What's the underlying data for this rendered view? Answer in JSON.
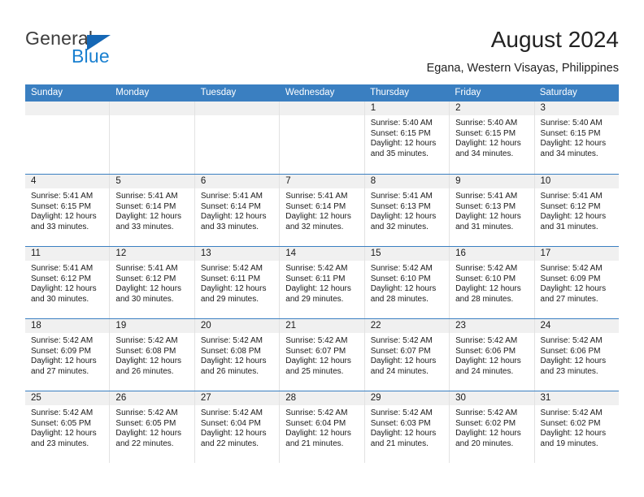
{
  "brand": {
    "name_top": "General",
    "name_bottom": "Blue",
    "triangle_color": "#1567b5",
    "blue_text_color": "#1a80d0"
  },
  "header": {
    "title": "August 2024",
    "location": "Egana, Western Visayas, Philippines"
  },
  "calendar": {
    "header_bg": "#3a7fc1",
    "day_band_bg": "#f0f0f0",
    "weekdays": [
      "Sunday",
      "Monday",
      "Tuesday",
      "Wednesday",
      "Thursday",
      "Friday",
      "Saturday"
    ],
    "weeks": [
      [
        {
          "day": "",
          "lines": []
        },
        {
          "day": "",
          "lines": []
        },
        {
          "day": "",
          "lines": []
        },
        {
          "day": "",
          "lines": []
        },
        {
          "day": "1",
          "lines": [
            "Sunrise: 5:40 AM",
            "Sunset: 6:15 PM",
            "Daylight: 12 hours and 35 minutes."
          ]
        },
        {
          "day": "2",
          "lines": [
            "Sunrise: 5:40 AM",
            "Sunset: 6:15 PM",
            "Daylight: 12 hours and 34 minutes."
          ]
        },
        {
          "day": "3",
          "lines": [
            "Sunrise: 5:40 AM",
            "Sunset: 6:15 PM",
            "Daylight: 12 hours and 34 minutes."
          ]
        }
      ],
      [
        {
          "day": "4",
          "lines": [
            "Sunrise: 5:41 AM",
            "Sunset: 6:15 PM",
            "Daylight: 12 hours and 33 minutes."
          ]
        },
        {
          "day": "5",
          "lines": [
            "Sunrise: 5:41 AM",
            "Sunset: 6:14 PM",
            "Daylight: 12 hours and 33 minutes."
          ]
        },
        {
          "day": "6",
          "lines": [
            "Sunrise: 5:41 AM",
            "Sunset: 6:14 PM",
            "Daylight: 12 hours and 33 minutes."
          ]
        },
        {
          "day": "7",
          "lines": [
            "Sunrise: 5:41 AM",
            "Sunset: 6:14 PM",
            "Daylight: 12 hours and 32 minutes."
          ]
        },
        {
          "day": "8",
          "lines": [
            "Sunrise: 5:41 AM",
            "Sunset: 6:13 PM",
            "Daylight: 12 hours and 32 minutes."
          ]
        },
        {
          "day": "9",
          "lines": [
            "Sunrise: 5:41 AM",
            "Sunset: 6:13 PM",
            "Daylight: 12 hours and 31 minutes."
          ]
        },
        {
          "day": "10",
          "lines": [
            "Sunrise: 5:41 AM",
            "Sunset: 6:12 PM",
            "Daylight: 12 hours and 31 minutes."
          ]
        }
      ],
      [
        {
          "day": "11",
          "lines": [
            "Sunrise: 5:41 AM",
            "Sunset: 6:12 PM",
            "Daylight: 12 hours and 30 minutes."
          ]
        },
        {
          "day": "12",
          "lines": [
            "Sunrise: 5:41 AM",
            "Sunset: 6:12 PM",
            "Daylight: 12 hours and 30 minutes."
          ]
        },
        {
          "day": "13",
          "lines": [
            "Sunrise: 5:42 AM",
            "Sunset: 6:11 PM",
            "Daylight: 12 hours and 29 minutes."
          ]
        },
        {
          "day": "14",
          "lines": [
            "Sunrise: 5:42 AM",
            "Sunset: 6:11 PM",
            "Daylight: 12 hours and 29 minutes."
          ]
        },
        {
          "day": "15",
          "lines": [
            "Sunrise: 5:42 AM",
            "Sunset: 6:10 PM",
            "Daylight: 12 hours and 28 minutes."
          ]
        },
        {
          "day": "16",
          "lines": [
            "Sunrise: 5:42 AM",
            "Sunset: 6:10 PM",
            "Daylight: 12 hours and 28 minutes."
          ]
        },
        {
          "day": "17",
          "lines": [
            "Sunrise: 5:42 AM",
            "Sunset: 6:09 PM",
            "Daylight: 12 hours and 27 minutes."
          ]
        }
      ],
      [
        {
          "day": "18",
          "lines": [
            "Sunrise: 5:42 AM",
            "Sunset: 6:09 PM",
            "Daylight: 12 hours and 27 minutes."
          ]
        },
        {
          "day": "19",
          "lines": [
            "Sunrise: 5:42 AM",
            "Sunset: 6:08 PM",
            "Daylight: 12 hours and 26 minutes."
          ]
        },
        {
          "day": "20",
          "lines": [
            "Sunrise: 5:42 AM",
            "Sunset: 6:08 PM",
            "Daylight: 12 hours and 26 minutes."
          ]
        },
        {
          "day": "21",
          "lines": [
            "Sunrise: 5:42 AM",
            "Sunset: 6:07 PM",
            "Daylight: 12 hours and 25 minutes."
          ]
        },
        {
          "day": "22",
          "lines": [
            "Sunrise: 5:42 AM",
            "Sunset: 6:07 PM",
            "Daylight: 12 hours and 24 minutes."
          ]
        },
        {
          "day": "23",
          "lines": [
            "Sunrise: 5:42 AM",
            "Sunset: 6:06 PM",
            "Daylight: 12 hours and 24 minutes."
          ]
        },
        {
          "day": "24",
          "lines": [
            "Sunrise: 5:42 AM",
            "Sunset: 6:06 PM",
            "Daylight: 12 hours and 23 minutes."
          ]
        }
      ],
      [
        {
          "day": "25",
          "lines": [
            "Sunrise: 5:42 AM",
            "Sunset: 6:05 PM",
            "Daylight: 12 hours and 23 minutes."
          ]
        },
        {
          "day": "26",
          "lines": [
            "Sunrise: 5:42 AM",
            "Sunset: 6:05 PM",
            "Daylight: 12 hours and 22 minutes."
          ]
        },
        {
          "day": "27",
          "lines": [
            "Sunrise: 5:42 AM",
            "Sunset: 6:04 PM",
            "Daylight: 12 hours and 22 minutes."
          ]
        },
        {
          "day": "28",
          "lines": [
            "Sunrise: 5:42 AM",
            "Sunset: 6:04 PM",
            "Daylight: 12 hours and 21 minutes."
          ]
        },
        {
          "day": "29",
          "lines": [
            "Sunrise: 5:42 AM",
            "Sunset: 6:03 PM",
            "Daylight: 12 hours and 21 minutes."
          ]
        },
        {
          "day": "30",
          "lines": [
            "Sunrise: 5:42 AM",
            "Sunset: 6:02 PM",
            "Daylight: 12 hours and 20 minutes."
          ]
        },
        {
          "day": "31",
          "lines": [
            "Sunrise: 5:42 AM",
            "Sunset: 6:02 PM",
            "Daylight: 12 hours and 19 minutes."
          ]
        }
      ]
    ]
  }
}
